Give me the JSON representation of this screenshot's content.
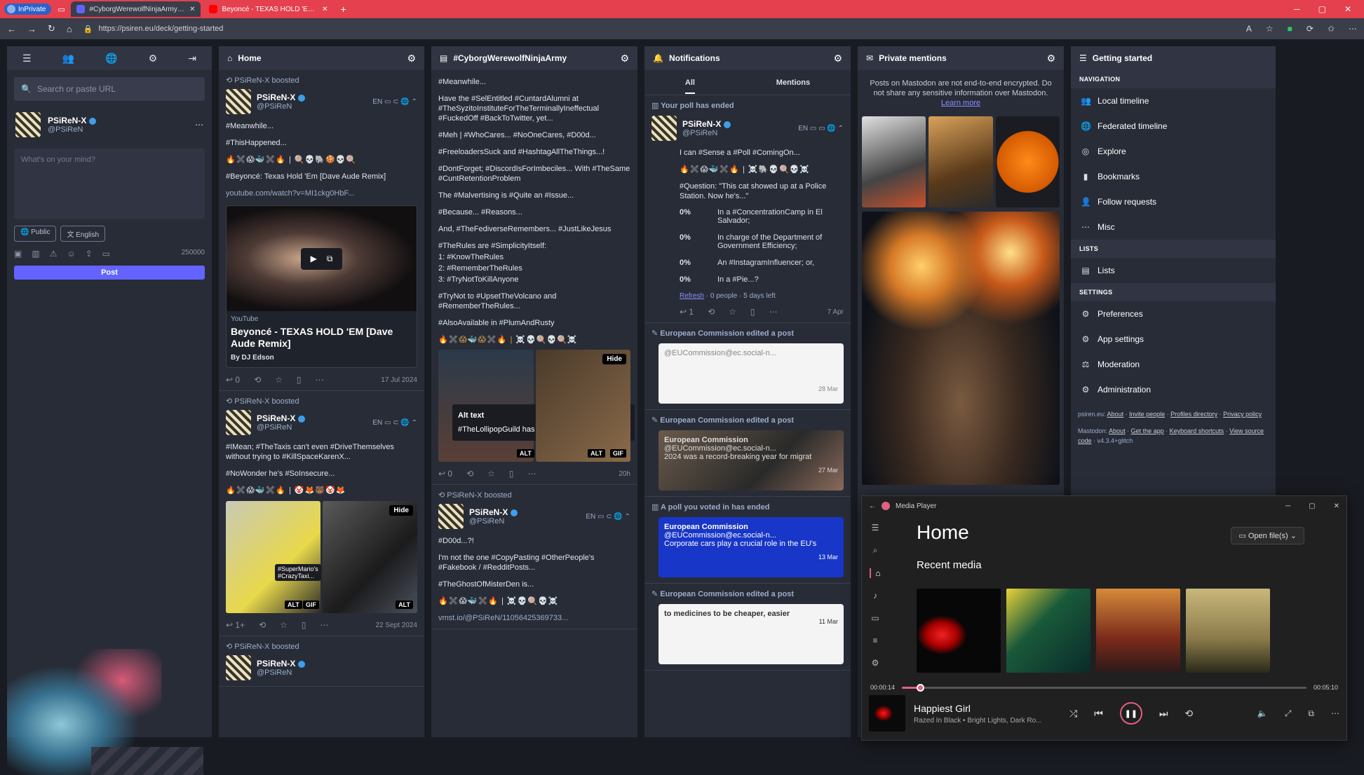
{
  "browser": {
    "private_label": "InPrivate",
    "tabs": [
      {
        "title": "#CyborgWerewolfNinjaArmy - #I"
      },
      {
        "title": "Beyoncé - TEXAS HOLD 'EM [Dav"
      }
    ],
    "url": "https://psiren.eu/deck/getting-started"
  },
  "nav": {
    "search_placeholder": "Search or paste URL"
  },
  "account": {
    "name": "PSiReN-X",
    "handle": "@PSiReN"
  },
  "compose": {
    "placeholder": "What's on your mind?",
    "visibility": "Public",
    "language": "English",
    "char_count": "250000",
    "post_label": "Post"
  },
  "home": {
    "title": "Home",
    "status1": {
      "boost": "PSiReN-X boosted",
      "name": "PSiReN-X",
      "handle": "@PSiReN",
      "lang": "EN",
      "l1": "#Meanwhile...",
      "l2": "#ThisHappened...",
      "emoji": "🔥✖️😱🐳✖️🔥 | 🍭💀🐘🍪💀🍭",
      "l3": "#Beyoncé: Texas Hold 'Em [Dave Aude Remix]",
      "link": "youtube.com/watch?v=MI1ckg0HbF...",
      "card_src": "YouTube",
      "card_title": "Beyoncé - TEXAS HOLD 'EM [Dave Aude Remix]",
      "card_by": "By DJ Edson",
      "replies": "0",
      "date": "17 Jul 2024"
    },
    "status2": {
      "boost": "PSiReN-X boosted",
      "name": "PSiReN-X",
      "handle": "@PSiReN",
      "lang": "EN",
      "l1": "#IMean; #TheTaxis can't even #DriveThemselves without trying to #KillSpaceKarenX...",
      "l2": "#NoWonder he's #SoInsecure...",
      "emoji": "🔥✖️😱🐳✖️🔥 | 🤡🦊🐻🤡🦊",
      "alt_tip": "#SuperMario's #CrazyTaxi...",
      "hide": "Hide",
      "badge_alt": "ALT",
      "badge_gif": "GIF",
      "replies": "1+",
      "date": "22 Sept 2024"
    },
    "status3": {
      "boost": "PSiReN-X boosted",
      "name": "PSiReN-X",
      "handle": "@PSiReN"
    }
  },
  "hashtag": {
    "title": "#CyborgWerewolfNinjaArmy",
    "lines": [
      "#Meanwhile...",
      "Have the #SelEntitled #CuntardAlumni at #TheSyzitoInstituteForTheTerminallyIneffectual #FuckedOff #BackToTwitter, yet...",
      "#Meh | #WhoCares... #NoOneCares, #D00d...",
      "#FreeloadersSuck and #HashtagAllTheThings...!",
      "#DontForget; #DiscordIsForImbeciles... With #TheSame #CuntRetentionProblem",
      "The #Malvertising is #Quite an #Issue...",
      "#Because... #Reasons...",
      "And, #TheFediverseRemembers... #JustLikeJesus",
      "#TheRules are #SimplicityItself:",
      "1: #KnowTheRules",
      "2: #RememberTheRules",
      "3: #TryNotToKillAnyone",
      "#TryNot to #UpsetTheVolcano and #RememberTheRules...",
      "#AlsoAvailable in #PlumAndRusty"
    ],
    "emoji": "🔥✖️😱🐳😱✖️🔥 | ☠️💀🍭💀🍭☠️",
    "hide": "Hide",
    "alt_title": "Alt text",
    "alt_body": "#TheLollipopGuild has a #SpecialBulletin...",
    "badge_alt": "ALT",
    "badge_gif": "GIF",
    "replies": "0",
    "date": "20h",
    "status2": {
      "boost": "PSiReN-X boosted",
      "name": "PSiReN-X",
      "handle": "@PSiReN",
      "lang": "EN",
      "l1": "#D00d...?!",
      "l2": "I'm not the one #CopyPasting #OtherPeople's #Fakebook / #RedditPosts...",
      "l3": "#TheGhostOfMisterDen is...",
      "emoji": "🔥✖️😱🐳✖️🔥 | ☠️💀🍭💀☠️",
      "link": "vmst.io/@PSiReN/11056425369733..."
    }
  },
  "notifications": {
    "title": "Notifications",
    "tab_all": "All",
    "tab_mentions": "Mentions",
    "poll_ended": "Your poll has ended",
    "poll_name": "PSiReN-X",
    "poll_handle": "@PSiReN",
    "poll_lang": "EN",
    "poll_q1": "I can #Sense a #Poll #ComingOn...",
    "poll_emoji": "🔥✖️😱🐳✖️🔥 | ☠️🐘💀🍭💀☠️",
    "poll_q2": "#Question: \"This cat showed up at a Police Station. Now he's...\"",
    "options": [
      {
        "pct": "0%",
        "text": "In a #ConcentrationCamp in El Salvador;"
      },
      {
        "pct": "0%",
        "text": "In charge of the Department of Government Efficiency;"
      },
      {
        "pct": "0%",
        "text": "An #InstagramInfluencer; or,"
      },
      {
        "pct": "0%",
        "text": "In a #Pie...?"
      }
    ],
    "refresh": "Refresh",
    "poll_meta": " · 0 people · 5 days left",
    "poll_date": "7 Apr",
    "poll_replies": "1",
    "edited1": "European Commission edited a post",
    "edited1_handle": "@EUCommission@ec.social-n...",
    "edited1_date": "28 Mar",
    "edited2": "European Commission edited a post",
    "edited2_name": "European Commission",
    "edited2_handle": "@EUCommission@ec.social-n...",
    "edited2_text": "2024 was a record-breaking year for migrat",
    "edited2_date": "27 Mar",
    "voted": "A poll you voted in has ended",
    "voted_name": "European Commission",
    "voted_handle": "@EUCommission@ec.social-n...",
    "voted_text": "Corporate cars play a crucial role in the EU's",
    "voted_date": "13 Mar",
    "edited3": "European Commission edited a post",
    "edited3_text": "to medicines to be cheaper, easier",
    "edited3_date": "11 Mar"
  },
  "mentions": {
    "title": "Private mentions",
    "warning": "Posts on Mastodon are not end-to-end encrypted. Do not share any sensitive information over Mastodon.",
    "learn_more": "Learn more"
  },
  "getting_started": {
    "title": "Getting started",
    "nav_header": "NAVIGATION",
    "nav": [
      "Local timeline",
      "Federated timeline",
      "Explore",
      "Bookmarks",
      "Follow requests",
      "Misc"
    ],
    "lists_header": "LISTS",
    "lists": [
      "Lists"
    ],
    "settings_header": "SETTINGS",
    "settings": [
      "Preferences",
      "App settings",
      "Moderation",
      "Administration"
    ],
    "footer1_site": "psiren.eu:",
    "footer1_links": [
      "About",
      "Invite people",
      "Profiles directory",
      "Privacy policy"
    ],
    "footer2_site": "Mastodon:",
    "footer2_links": [
      "About",
      "Get the app",
      "Keyboard shortcuts",
      "View source code"
    ],
    "version": "v4.3.4+glitch"
  },
  "media_player": {
    "title": "Media Player",
    "home": "Home",
    "open_files": "Open file(s)",
    "recent": "Recent media",
    "elapsed": "00:00:14",
    "total": "00:05:10",
    "progress": 0.045,
    "song": "Happiest Girl",
    "artist": "Razed In Black • Bright Lights, Dark Ro..."
  },
  "colors": {
    "accent": "#6364ff",
    "tabbar": "#e5404d",
    "player_accent": "#e06080"
  }
}
